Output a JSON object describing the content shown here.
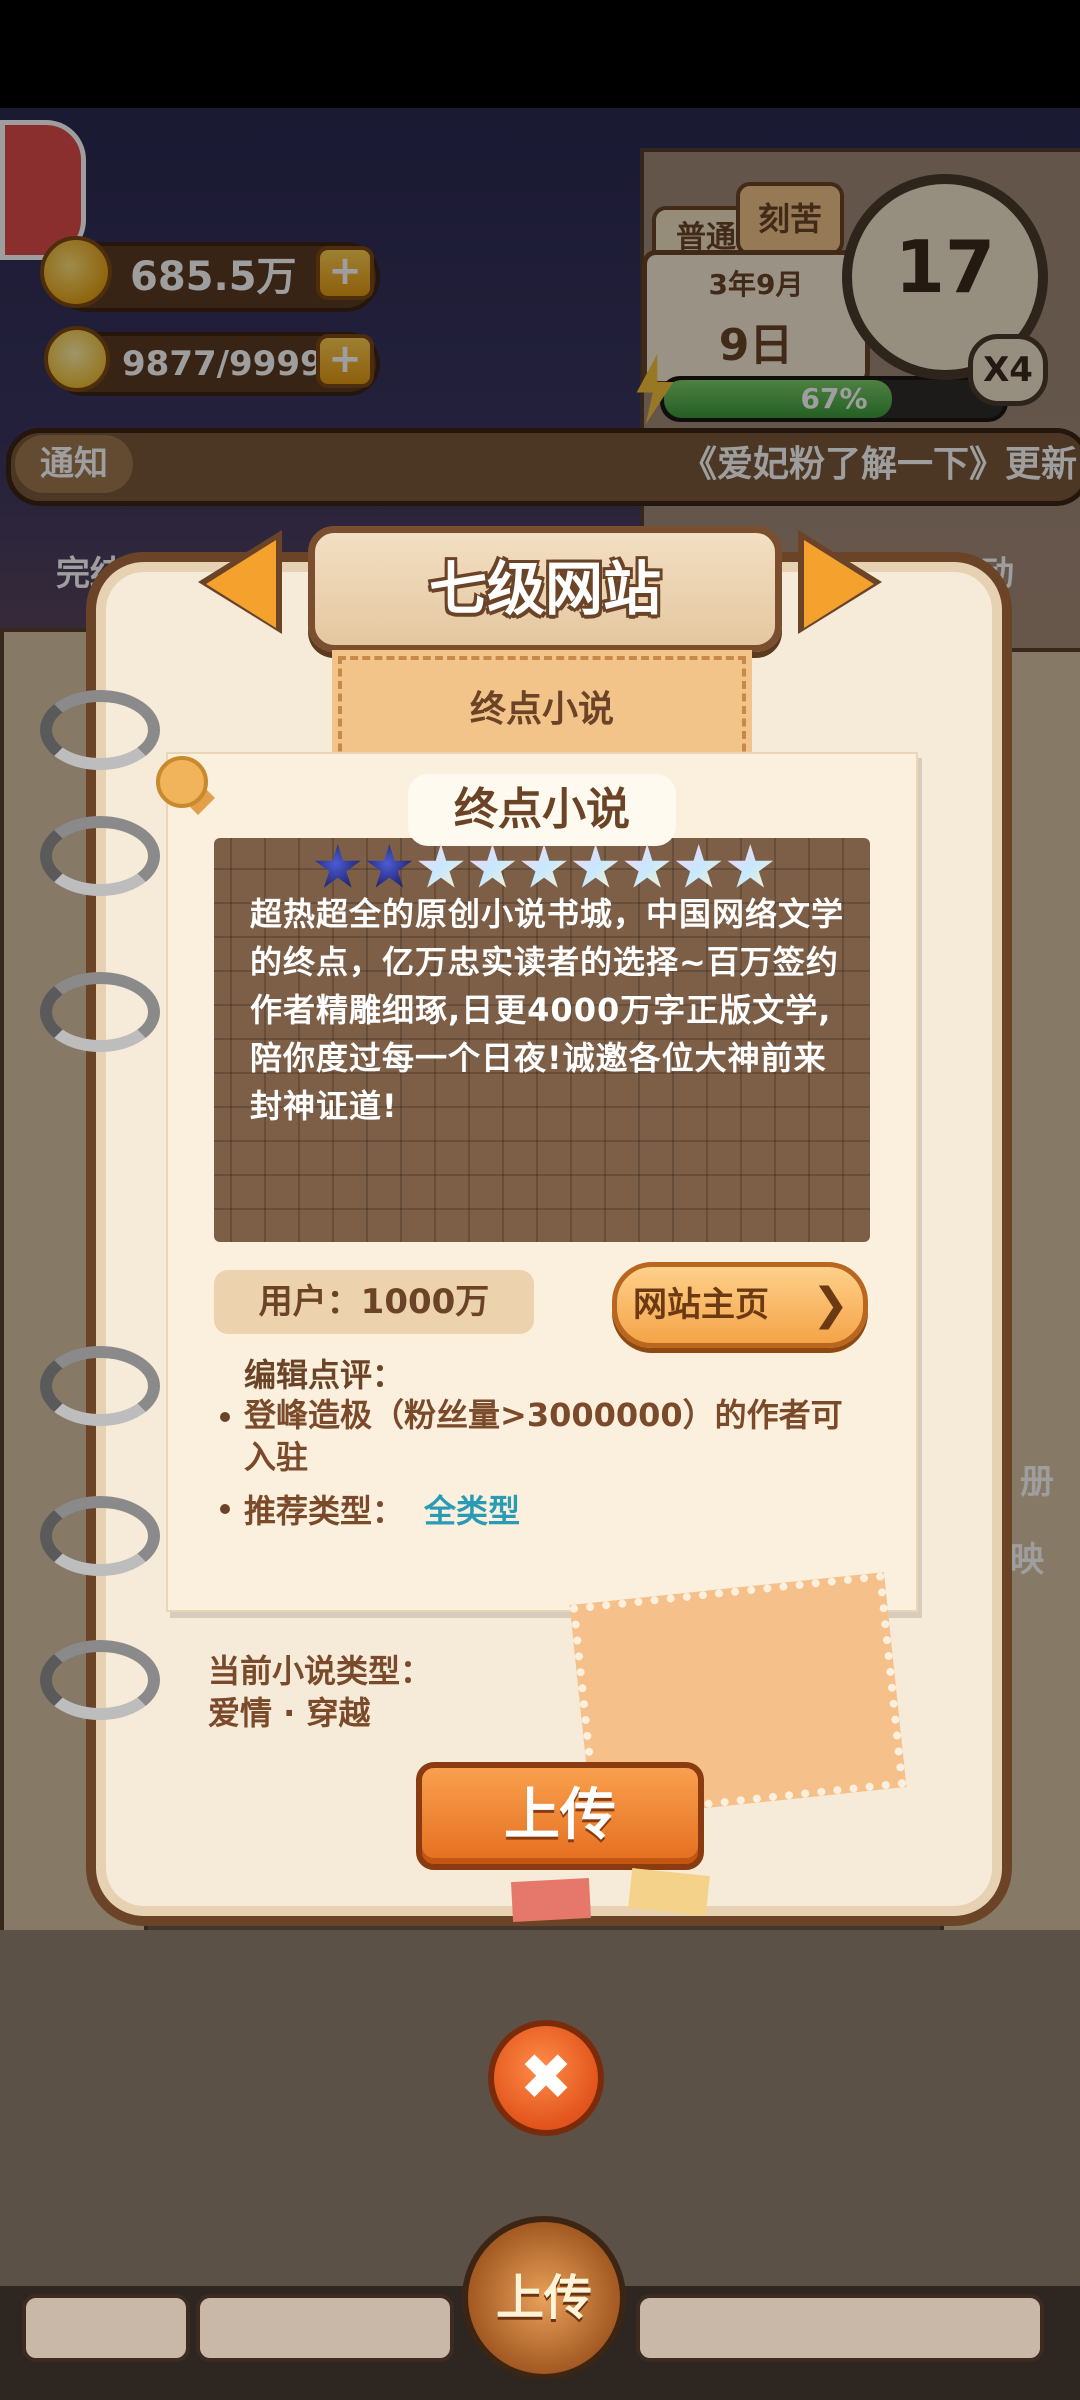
{
  "hud": {
    "money": "685.5万",
    "inspiration": "9877/9999",
    "mode_normal": "普通",
    "mode_hard": "刻苦",
    "date_month": "3年9月",
    "date_day": "9日",
    "stamina": "67%",
    "stamina_fraction": 0.67,
    "level": "17",
    "multiplier": "X4"
  },
  "notice": {
    "label": "通知",
    "text": "《爱妃粉了解一下》更新"
  },
  "side": {
    "left_label": "完结",
    "right_label": "行动",
    "right_label_2": "册",
    "right_label_3": "映"
  },
  "dialog": {
    "title": "七级网站",
    "site_tab": "终点小说",
    "site_name": "终点小说",
    "stars_on": 2,
    "stars_total": 9,
    "description": "超热超全的原创小说书城，中国网络文学的终点，亿万忠实读者的选择~百万签约作者精雕细琢,日更4000万字正版文学,陪你度过每一个日夜!诚邀各位大神前来封神证道!",
    "users": "用户：1000万",
    "homepage_button": "网站主页",
    "homepage_chevron": "❯",
    "review_title": "编辑点评：",
    "review_line": "登峰造极（粉丝量>3000000）的作者可入驻",
    "recommend_label": "推荐类型：",
    "recommend_value": "全类型",
    "current_type_label": "当前小说类型：",
    "current_type_value": "爱情 · 穿越",
    "upload_button": "上传",
    "close_icon": "✖"
  },
  "bottom": {
    "upload_label": "上传"
  },
  "colors": {
    "accent_orange": "#f5a12d",
    "frame_brown": "#6b4428",
    "recommend_blue": "#2a9bb5"
  }
}
